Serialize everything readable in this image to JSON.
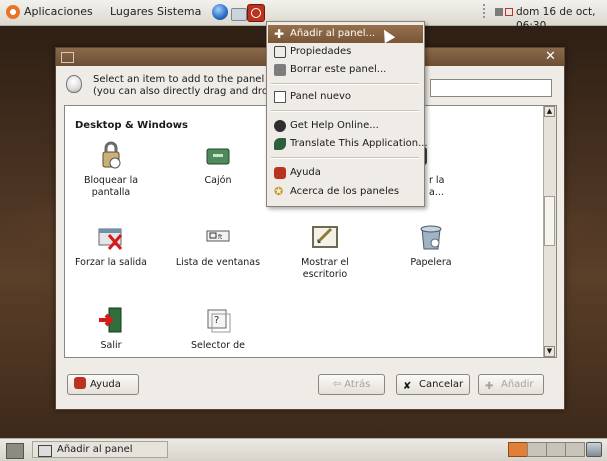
{
  "top_panel": {
    "menus": [
      "Aplicaciones",
      "Lugares",
      "Sistema"
    ],
    "clock": "dom 16 de oct, 06:30"
  },
  "dialog": {
    "hint": "Select an item to add to the panel\n(you can also directly drag and drop)",
    "section_title": "Desktop & Windows",
    "items": [
      "Bloquear la\npantalla",
      "Cajón",
      "r la\na...",
      "Forzar la salida",
      "Lista de ventanas",
      "Mostrar el\nescritorio",
      "Papelera",
      "Salir",
      "Selector de"
    ],
    "buttons": {
      "help": "Ayuda",
      "back": "Atrás",
      "cancel": "Cancelar",
      "add": "Añadir"
    }
  },
  "context_menu": {
    "items": [
      "Añadir al panel...",
      "Propiedades",
      "Borrar este panel...",
      "Panel nuevo",
      "Get Help Online...",
      "Translate This Application...",
      "Ayuda",
      "Acerca de los paneles"
    ]
  },
  "bottom_panel": {
    "task_label": "Añadir al panel"
  }
}
